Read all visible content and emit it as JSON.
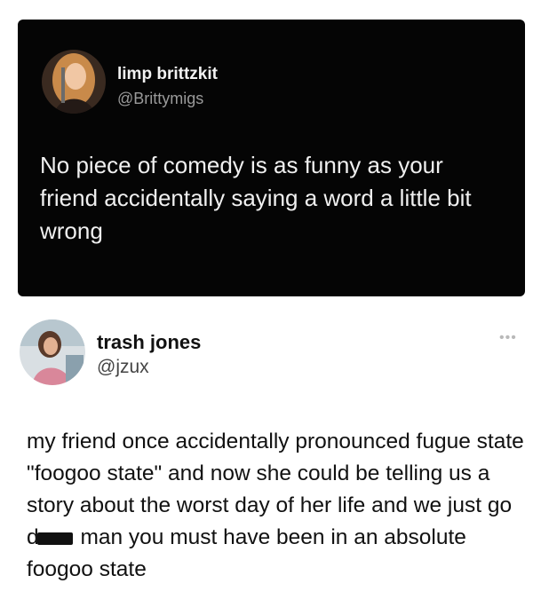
{
  "tweet1": {
    "display_name": "limp brittzkit",
    "handle": "@Brittymigs",
    "text": "No piece of comedy is as funny as your friend accidentally saying a word a little bit wrong"
  },
  "tweet2": {
    "display_name": "trash jones",
    "handle": "@jzux",
    "more_icon": "more-dots-icon",
    "text_before": "my friend once accidentally pronounced fugue state \"foogoo state\" and now she could be telling us a story about the worst day of her life and we just go d",
    "text_after": " man you must have been in an absolute foogoo state"
  }
}
